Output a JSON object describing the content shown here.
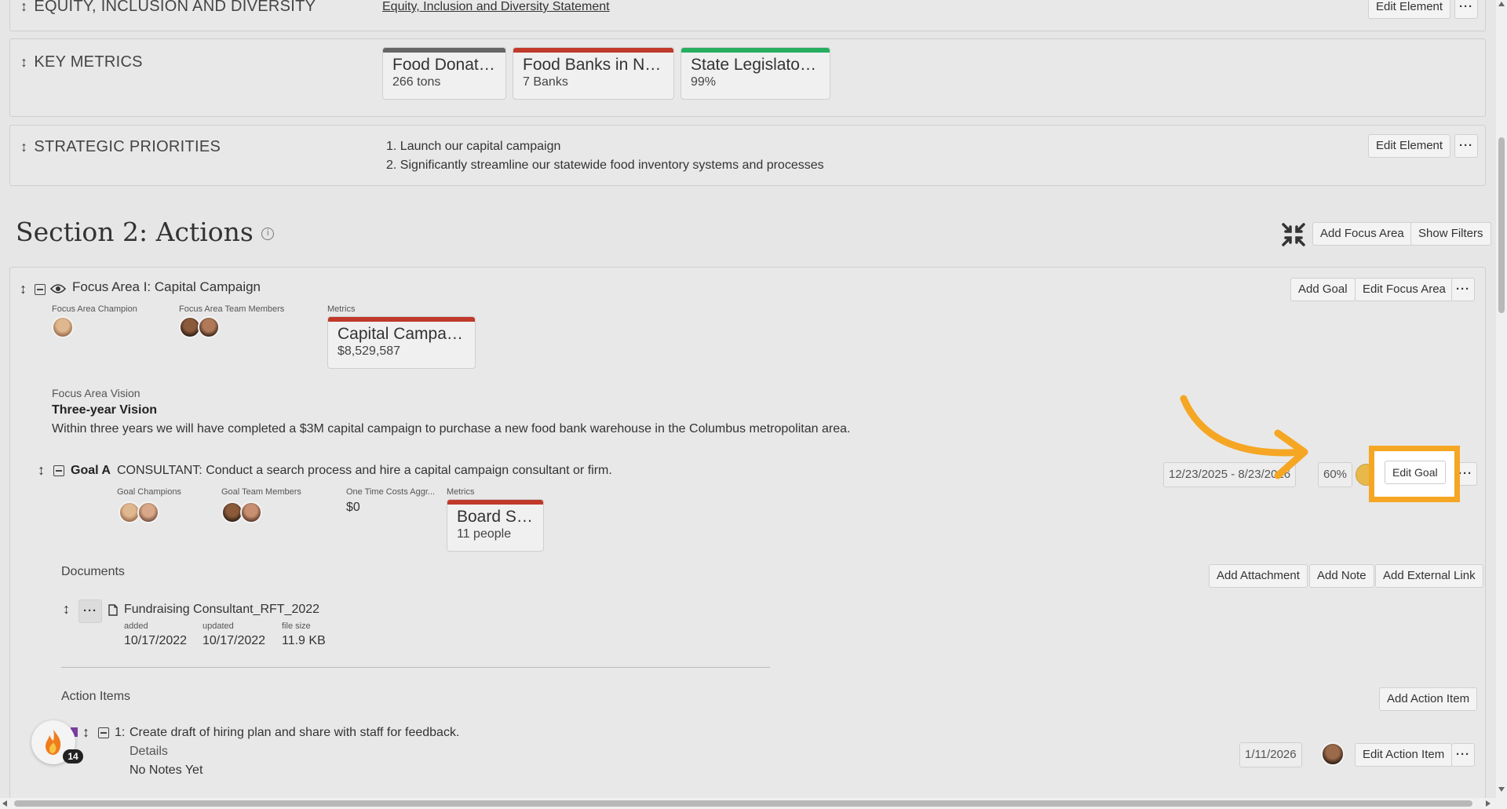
{
  "sections": {
    "equity": {
      "label": "EQUITY, INCLUSION AND DIVERSITY",
      "link": "Equity, Inclusion and Diversity Statement",
      "edit": "Edit Element"
    },
    "key_metrics": {
      "label": "KEY METRICS",
      "cards": [
        {
          "title": "Food Donated",
          "value": "266 tons",
          "color": "#666666"
        },
        {
          "title": "Food Banks in Net...",
          "value": "7 Banks",
          "color": "#c0392b"
        },
        {
          "title": "State Legislators...",
          "value": "99%",
          "color": "#27ae60"
        }
      ]
    },
    "strategic": {
      "label": "STRATEGIC PRIORITIES",
      "items": [
        "Launch our capital campaign",
        "Significantly streamline our statewide food inventory systems and processes"
      ],
      "edit": "Edit Element"
    }
  },
  "actions": {
    "title": "Section 2: Actions",
    "add_focus_area": "Add Focus Area",
    "show_filters": "Show Filters"
  },
  "focus_area": {
    "title": "Focus Area I: Capital Campaign",
    "add_goal": "Add Goal",
    "edit_focus_area": "Edit Focus Area",
    "champion_label": "Focus Area Champion",
    "team_label": "Focus Area Team Members",
    "metrics_label": "Metrics",
    "metric": {
      "title": "Capital Campaign",
      "value": "$8,529,587",
      "color": "#c0392b"
    },
    "vision_label": "Focus Area Vision",
    "vision_title": "Three-year Vision",
    "vision_text": "Within three years we will have completed a $3M capital campaign to purchase a new food bank warehouse in the Columbus metropolitan area."
  },
  "goal": {
    "name": "Goal A",
    "text": "CONSULTANT: Conduct a search process and hire a capital campaign consultant or firm.",
    "dates": "12/23/2025 - 8/23/2026",
    "percent": "60%",
    "edit": "Edit Goal",
    "champions_label": "Goal Champions",
    "team_label": "Goal Team Members",
    "costs_label": "One Time Costs Aggr...",
    "costs_value": "$0",
    "metrics_label": "Metrics",
    "metric": {
      "title": "Board Size",
      "value": "11 people",
      "color": "#c0392b"
    }
  },
  "documents": {
    "label": "Documents",
    "add_attachment": "Add Attachment",
    "add_note": "Add Note",
    "add_external_link": "Add External Link",
    "file": {
      "name": "Fundraising Consultant_RFT_2022",
      "added_label": "added",
      "added": "10/17/2022",
      "updated_label": "updated",
      "updated": "10/17/2022",
      "size_label": "file size",
      "size": "11.9 KB"
    }
  },
  "action_items": {
    "label": "Action Items",
    "add": "Add Action Item",
    "item": {
      "num": "1:",
      "text": "Create draft of hiring plan and share with staff for feedback.",
      "details": "Details",
      "notes": "No Notes Yet",
      "date": "1/11/2026",
      "edit": "Edit Action Item"
    }
  },
  "badge": {
    "count": "14"
  },
  "highlight_color": "#f5a623"
}
